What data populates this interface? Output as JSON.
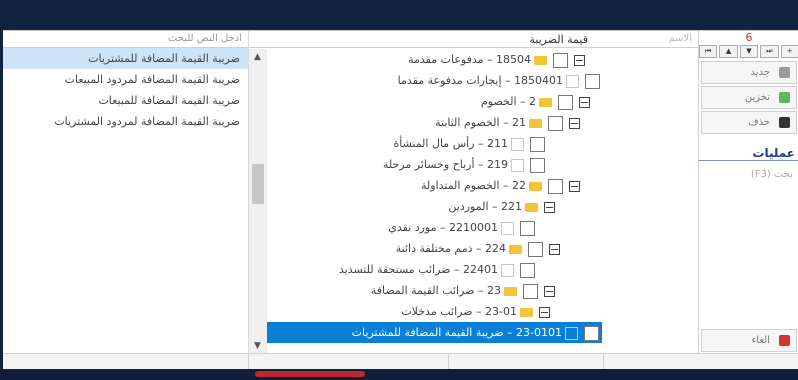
{
  "left_panel": {
    "search_placeholder": "ادخل النص للبحث",
    "items": [
      {
        "label": "ضريبة القيمة المضافة للمشتريات",
        "selected": true
      },
      {
        "label": "ضريبة القيمة المضافة لمردود المبيعات",
        "selected": false
      },
      {
        "label": "ضريبة القيمة المضافة للمبيعات",
        "selected": false
      },
      {
        "label": "ضريبة القيمة المضافة لمردود المشتريات",
        "selected": false
      }
    ]
  },
  "header": {
    "name_label": "الاسم",
    "value": "قيمة الضريبة"
  },
  "tree": [
    {
      "text": "18504 – مدفوعات مقدمة",
      "expander": true,
      "checkbox": true,
      "folder": true,
      "style": "normal"
    },
    {
      "text": "1850401 – إيجارات مدفوعة مقدما",
      "expander": false,
      "checkbox": true,
      "folder": false,
      "style": "leaf"
    },
    {
      "text": "2 – الخصوم",
      "expander": true,
      "checkbox": true,
      "folder": true,
      "style": "normal"
    },
    {
      "text": "21 – الخصوم الثابتة",
      "expander": true,
      "checkbox": true,
      "folder": true,
      "style": "normal"
    },
    {
      "text": "211 – رأس مال المنشأة",
      "expander": false,
      "checkbox": true,
      "folder": false,
      "style": "leaf"
    },
    {
      "text": "219 – أرباح وخسائر مرحلة",
      "expander": false,
      "checkbox": true,
      "folder": false,
      "style": "leaf"
    },
    {
      "text": "22 – الخصوم المتداولة",
      "expander": true,
      "checkbox": true,
      "folder": true,
      "style": "normal"
    },
    {
      "text": "221 – الموردين",
      "expander": true,
      "checkbox": false,
      "folder": true,
      "style": "normal"
    },
    {
      "text": "2210001 – مورد نقدي",
      "expander": false,
      "checkbox": true,
      "folder": false,
      "style": "leaf"
    },
    {
      "text": "224 – ذمم مختلفة دائنة",
      "expander": true,
      "checkbox": true,
      "folder": true,
      "style": "normal"
    },
    {
      "text": "22401 – ضرائب مستحقة للتسديد",
      "expander": false,
      "checkbox": true,
      "folder": false,
      "style": "leaf"
    },
    {
      "text": "23 – ضرائب القيمة المضافة",
      "expander": true,
      "checkbox": true,
      "folder": true,
      "style": "normal"
    },
    {
      "text": "23-01 – ضرائب مدخلات",
      "expander": true,
      "checkbox": false,
      "folder": true,
      "style": "normal"
    },
    {
      "text": "23-0101 – ضريبة القيمة المضافة للمشتريات",
      "expander": false,
      "checkbox": true,
      "folder": false,
      "style": "selected"
    }
  ],
  "right_panel": {
    "count": "6",
    "nav_arrows": [
      "⏮",
      "▲",
      "▼",
      "⏭",
      "+"
    ],
    "buttons": {
      "new": "جديد",
      "save": "تخزين",
      "delete": "حذف"
    },
    "section_title": "عمليات",
    "search_hint": "بحث (F3)",
    "cancel": "الغاء"
  },
  "colors": {
    "selection": "#0a7fd8",
    "folder": "#f4c338",
    "left_selection": "#cde3f7",
    "cancel_icon": "#d9342b"
  },
  "icons": [
    "folder-icon",
    "checkbox-icon",
    "expander-icon",
    "plus-icon",
    "save-icon",
    "delete-icon",
    "cancel-icon"
  ]
}
